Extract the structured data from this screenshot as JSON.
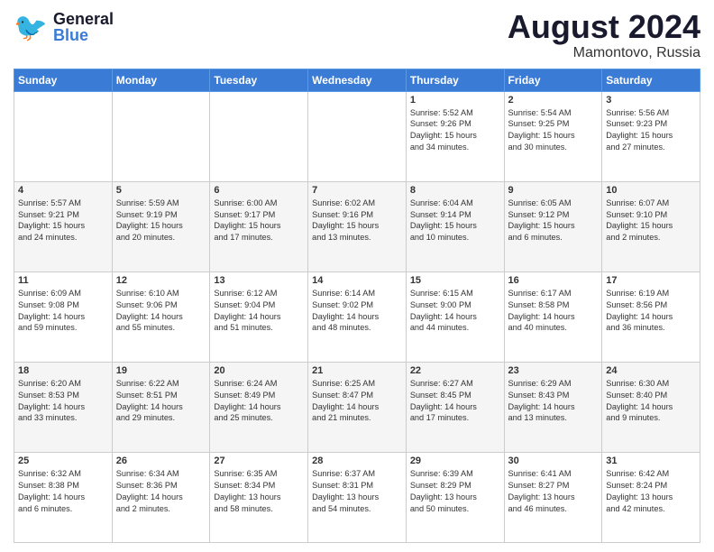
{
  "header": {
    "logo": {
      "general": "General",
      "blue": "Blue"
    },
    "title": "August 2024",
    "location": "Mamontovo, Russia"
  },
  "days_header": [
    "Sunday",
    "Monday",
    "Tuesday",
    "Wednesday",
    "Thursday",
    "Friday",
    "Saturday"
  ],
  "weeks": [
    [
      {
        "day": "",
        "info": ""
      },
      {
        "day": "",
        "info": ""
      },
      {
        "day": "",
        "info": ""
      },
      {
        "day": "",
        "info": ""
      },
      {
        "day": "1",
        "info": "Sunrise: 5:52 AM\nSunset: 9:26 PM\nDaylight: 15 hours\nand 34 minutes."
      },
      {
        "day": "2",
        "info": "Sunrise: 5:54 AM\nSunset: 9:25 PM\nDaylight: 15 hours\nand 30 minutes."
      },
      {
        "day": "3",
        "info": "Sunrise: 5:56 AM\nSunset: 9:23 PM\nDaylight: 15 hours\nand 27 minutes."
      }
    ],
    [
      {
        "day": "4",
        "info": "Sunrise: 5:57 AM\nSunset: 9:21 PM\nDaylight: 15 hours\nand 24 minutes."
      },
      {
        "day": "5",
        "info": "Sunrise: 5:59 AM\nSunset: 9:19 PM\nDaylight: 15 hours\nand 20 minutes."
      },
      {
        "day": "6",
        "info": "Sunrise: 6:00 AM\nSunset: 9:17 PM\nDaylight: 15 hours\nand 17 minutes."
      },
      {
        "day": "7",
        "info": "Sunrise: 6:02 AM\nSunset: 9:16 PM\nDaylight: 15 hours\nand 13 minutes."
      },
      {
        "day": "8",
        "info": "Sunrise: 6:04 AM\nSunset: 9:14 PM\nDaylight: 15 hours\nand 10 minutes."
      },
      {
        "day": "9",
        "info": "Sunrise: 6:05 AM\nSunset: 9:12 PM\nDaylight: 15 hours\nand 6 minutes."
      },
      {
        "day": "10",
        "info": "Sunrise: 6:07 AM\nSunset: 9:10 PM\nDaylight: 15 hours\nand 2 minutes."
      }
    ],
    [
      {
        "day": "11",
        "info": "Sunrise: 6:09 AM\nSunset: 9:08 PM\nDaylight: 14 hours\nand 59 minutes."
      },
      {
        "day": "12",
        "info": "Sunrise: 6:10 AM\nSunset: 9:06 PM\nDaylight: 14 hours\nand 55 minutes."
      },
      {
        "day": "13",
        "info": "Sunrise: 6:12 AM\nSunset: 9:04 PM\nDaylight: 14 hours\nand 51 minutes."
      },
      {
        "day": "14",
        "info": "Sunrise: 6:14 AM\nSunset: 9:02 PM\nDaylight: 14 hours\nand 48 minutes."
      },
      {
        "day": "15",
        "info": "Sunrise: 6:15 AM\nSunset: 9:00 PM\nDaylight: 14 hours\nand 44 minutes."
      },
      {
        "day": "16",
        "info": "Sunrise: 6:17 AM\nSunset: 8:58 PM\nDaylight: 14 hours\nand 40 minutes."
      },
      {
        "day": "17",
        "info": "Sunrise: 6:19 AM\nSunset: 8:56 PM\nDaylight: 14 hours\nand 36 minutes."
      }
    ],
    [
      {
        "day": "18",
        "info": "Sunrise: 6:20 AM\nSunset: 8:53 PM\nDaylight: 14 hours\nand 33 minutes."
      },
      {
        "day": "19",
        "info": "Sunrise: 6:22 AM\nSunset: 8:51 PM\nDaylight: 14 hours\nand 29 minutes."
      },
      {
        "day": "20",
        "info": "Sunrise: 6:24 AM\nSunset: 8:49 PM\nDaylight: 14 hours\nand 25 minutes."
      },
      {
        "day": "21",
        "info": "Sunrise: 6:25 AM\nSunset: 8:47 PM\nDaylight: 14 hours\nand 21 minutes."
      },
      {
        "day": "22",
        "info": "Sunrise: 6:27 AM\nSunset: 8:45 PM\nDaylight: 14 hours\nand 17 minutes."
      },
      {
        "day": "23",
        "info": "Sunrise: 6:29 AM\nSunset: 8:43 PM\nDaylight: 14 hours\nand 13 minutes."
      },
      {
        "day": "24",
        "info": "Sunrise: 6:30 AM\nSunset: 8:40 PM\nDaylight: 14 hours\nand 9 minutes."
      }
    ],
    [
      {
        "day": "25",
        "info": "Sunrise: 6:32 AM\nSunset: 8:38 PM\nDaylight: 14 hours\nand 6 minutes."
      },
      {
        "day": "26",
        "info": "Sunrise: 6:34 AM\nSunset: 8:36 PM\nDaylight: 14 hours\nand 2 minutes."
      },
      {
        "day": "27",
        "info": "Sunrise: 6:35 AM\nSunset: 8:34 PM\nDaylight: 13 hours\nand 58 minutes."
      },
      {
        "day": "28",
        "info": "Sunrise: 6:37 AM\nSunset: 8:31 PM\nDaylight: 13 hours\nand 54 minutes."
      },
      {
        "day": "29",
        "info": "Sunrise: 6:39 AM\nSunset: 8:29 PM\nDaylight: 13 hours\nand 50 minutes."
      },
      {
        "day": "30",
        "info": "Sunrise: 6:41 AM\nSunset: 8:27 PM\nDaylight: 13 hours\nand 46 minutes."
      },
      {
        "day": "31",
        "info": "Sunrise: 6:42 AM\nSunset: 8:24 PM\nDaylight: 13 hours\nand 42 minutes."
      }
    ]
  ]
}
